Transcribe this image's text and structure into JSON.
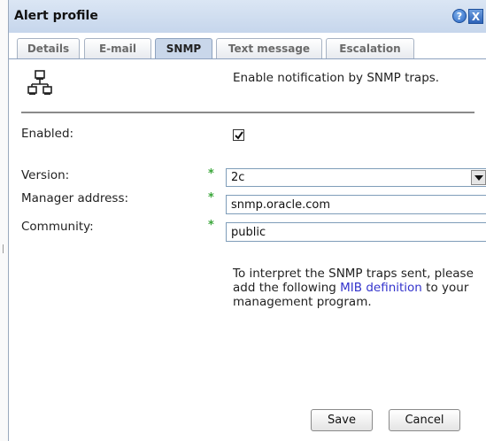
{
  "dialog": {
    "title": "Alert profile",
    "help_glyph": "?",
    "close_glyph": "X"
  },
  "tabs": [
    {
      "label": "Details",
      "active": false
    },
    {
      "label": "E-mail",
      "active": false
    },
    {
      "label": "SNMP",
      "active": true
    },
    {
      "label": "Text message",
      "active": false
    },
    {
      "label": "Escalation",
      "active": false
    }
  ],
  "snmp": {
    "intro": "Enable notification by SNMP traps.",
    "icon": "network-icon",
    "enabled_label": "Enabled:",
    "enabled": true,
    "required_mark": "*",
    "version_label": "Version:",
    "version_value": "2c",
    "manager_label": "Manager address:",
    "manager_value": "snmp.oracle.com",
    "community_label": "Community:",
    "community_value": "public",
    "info_before": "To interpret the SNMP traps sent, please add the following ",
    "info_link": "MIB definition",
    "info_after": " to your management program."
  },
  "buttons": {
    "save": "Save",
    "cancel": "Cancel"
  },
  "colors": {
    "titlebar": "#c6d6ec",
    "active_tab": "#c9d7ea",
    "required": "#3aa63a",
    "link": "#3333cc"
  }
}
